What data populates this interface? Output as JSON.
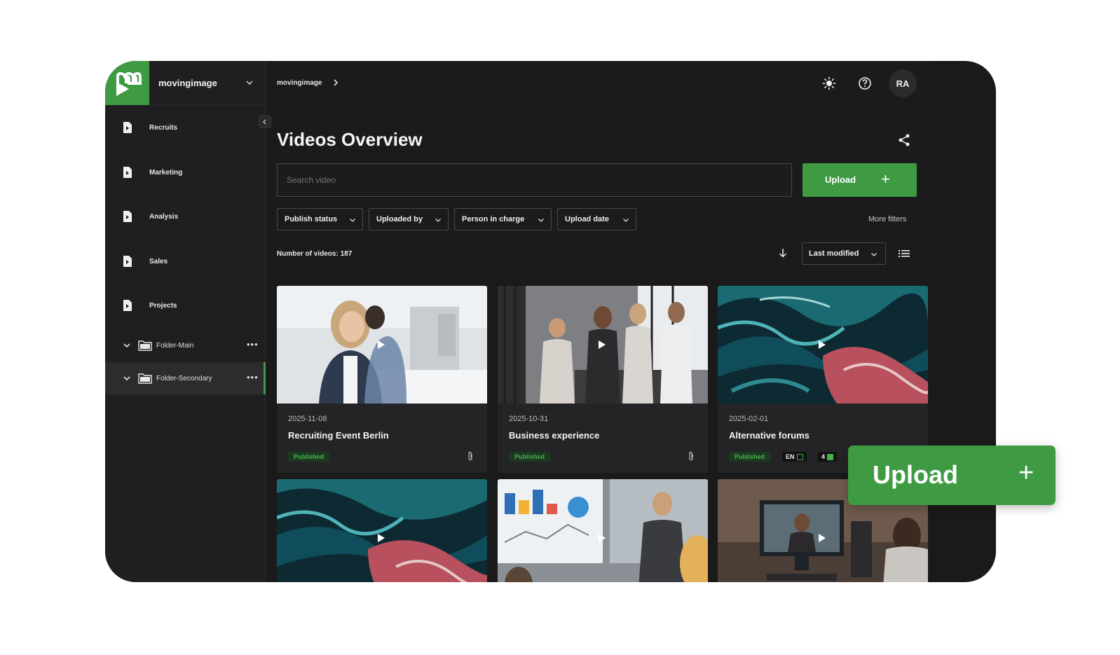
{
  "brand": {
    "name": "movingimage",
    "accent": "#3f9b43"
  },
  "sidebar": {
    "items": [
      {
        "label": "Recruits",
        "icon": "document-icon"
      },
      {
        "label": "Marketing",
        "icon": "document-icon"
      },
      {
        "label": "Analysis",
        "icon": "document-icon"
      },
      {
        "label": "Sales",
        "icon": "document-icon"
      },
      {
        "label": "Projects",
        "icon": "document-icon"
      }
    ],
    "folders": [
      {
        "label": "Folder-Main",
        "menu": "•••"
      },
      {
        "label": "Folder-Secondary",
        "menu": "•••",
        "active": true
      }
    ]
  },
  "topbar": {
    "breadcrumb": "movingimage",
    "avatar_initials": "RA"
  },
  "main": {
    "title": "Videos Overview",
    "search_placeholder": "Search video",
    "upload_label": "Upload",
    "upload_plus": "+",
    "filters": [
      "Publish status",
      "Uploaded by",
      "Person in charge",
      "Upload date"
    ],
    "more_filters": "More filters",
    "count_label": "Number of videos: 187",
    "sort_label": "Last modified"
  },
  "videos": [
    {
      "date": "2025-11-08",
      "title": "Recruiting Event Berlin",
      "status": "Published",
      "attachment": true
    },
    {
      "date": "2025-10-31",
      "title": "Business experience",
      "status": "Published",
      "attachment": true
    },
    {
      "date": "2025-02-01",
      "title": "Alternative forums",
      "status": "Published",
      "lang": "EN",
      "subtitle_count": "4"
    }
  ],
  "overlay": {
    "label": "Upload",
    "plus": "+"
  }
}
